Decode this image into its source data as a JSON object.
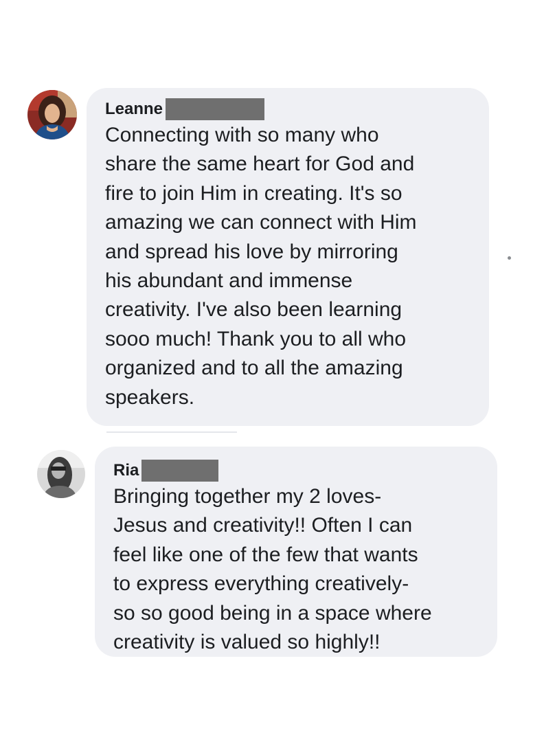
{
  "comments": [
    {
      "author_first_name": "Leanne",
      "avatar_icon": "profile-photo-icon",
      "text": "Connecting with so many who\nshare the same heart for God and\nfire to join Him in creating. It's so\namazing we can connect with Him\nand spread his love by mirroring\nhis abundant and immense\ncreativity. I've also been learning\nsooo much! Thank you to all who\norganized and to all the amazing\nspeakers."
    },
    {
      "author_first_name": "Ria",
      "avatar_icon": "profile-photo-icon",
      "text": "Bringing together my 2 loves-\nJesus and creativity!! Often I can\nfeel like one of the few that wants\nto express everything creatively-\nso so good being in a space where\ncreativity is valued so highly!!"
    }
  ],
  "colors": {
    "bubble_background": "#eff0f4",
    "text": "#1c1e21",
    "redaction": "#6f6f6f"
  }
}
